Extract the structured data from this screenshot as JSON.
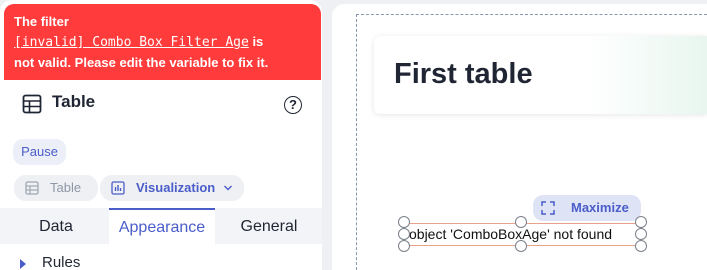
{
  "error_banner": {
    "line1": "The filter",
    "variable": "[invalid] Combo Box Filter Age",
    "after_variable": "is",
    "line3": "not valid. Please edit the variable to fix it."
  },
  "panel": {
    "title": "Table",
    "help": "?",
    "pause_label": "Pause",
    "pills": {
      "table": "Table",
      "visualization": "Visualization"
    },
    "tabs": {
      "data": "Data",
      "appearance": "Appearance",
      "general": "General"
    },
    "active_tab": "Appearance",
    "rules_label": "Rules"
  },
  "canvas": {
    "card_title": "First table",
    "maximize_label": "Maximize",
    "error_message": "object 'ComboBoxAge' not found"
  },
  "colors": {
    "error": "#ff3b3b",
    "accent": "#4a5dc9"
  }
}
